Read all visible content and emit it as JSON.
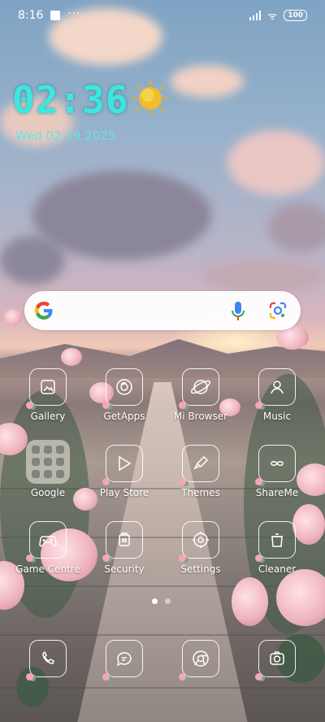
{
  "status_bar": {
    "time": "8:16",
    "battery": "100"
  },
  "widget": {
    "time": "02:36",
    "date": "Wed 02.19.2025",
    "weather_icon": "sun-icon"
  },
  "search": {
    "logo": "google-g-icon",
    "voice": "mic-icon",
    "lens": "google-lens-icon"
  },
  "apps": [
    {
      "label": "Gallery",
      "icon": "gallery-icon"
    },
    {
      "label": "GetApps",
      "icon": "getapps-icon"
    },
    {
      "label": "Mi Browser",
      "icon": "browser-icon"
    },
    {
      "label": "Music",
      "icon": "music-icon"
    },
    {
      "label": "Google",
      "icon": "google-folder-icon"
    },
    {
      "label": "Play Store",
      "icon": "play-store-icon"
    },
    {
      "label": "Themes",
      "icon": "themes-icon"
    },
    {
      "label": "ShareMe",
      "icon": "shareme-icon"
    },
    {
      "label": "Game Centre",
      "icon": "gamepad-icon"
    },
    {
      "label": "Security",
      "icon": "security-icon"
    },
    {
      "label": "Settings",
      "icon": "settings-icon"
    },
    {
      "label": "Cleaner",
      "icon": "cleaner-icon"
    }
  ],
  "pager": {
    "pages": 2,
    "current": 1
  },
  "dock": [
    {
      "icon": "phone-icon"
    },
    {
      "icon": "messages-icon"
    },
    {
      "icon": "chrome-icon"
    },
    {
      "icon": "camera-icon"
    }
  ],
  "colors": {
    "clock": "#3ee6e0",
    "date": "#66e2e0"
  }
}
